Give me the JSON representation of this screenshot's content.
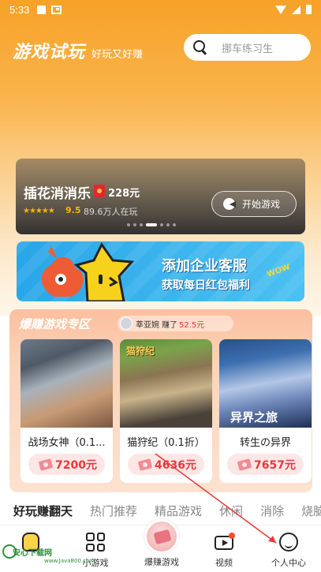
{
  "status_bar": {
    "time": "5:33"
  },
  "header": {
    "title": "游戏试玩",
    "subtitle": "好玩又好赚"
  },
  "search": {
    "placeholder": "挪车练习生"
  },
  "banner": {
    "game_name": "插花消消乐",
    "reward": "228元",
    "stars": "★★★★★",
    "rating": "9.5",
    "players": "89.6万人在玩",
    "start_label": "开始游戏",
    "slide_count": 7,
    "active_slide": 4
  },
  "promo": {
    "line1": "添加企业客服",
    "line2": "获取每日红包福利",
    "badge": "WOW"
  },
  "zone": {
    "title": "爆赚游戏专区",
    "ticker": {
      "name": "莘亚婉",
      "earned_label": "赚了",
      "amount": "52.5元"
    },
    "games": [
      {
        "name": "战场女神（0.1...",
        "price": "7200元",
        "art_label": ""
      },
      {
        "name": "猫狩纪（0.1折）",
        "price": "4636元",
        "art_label": "猫狩纪"
      },
      {
        "name": "转生の异界",
        "price": "7657元",
        "art_label": "异界之旅"
      }
    ]
  },
  "tabs": [
    "好玩赚翻天",
    "热门推荐",
    "精品游戏",
    "休闲",
    "消除",
    "烧脑"
  ],
  "bottom_nav": {
    "items": [
      {
        "label": "",
        "icon": "bear-icon"
      },
      {
        "label": "小游戏",
        "icon": "grid-icon"
      },
      {
        "label": "爆赚游戏",
        "icon": "money-icon"
      },
      {
        "label": "视频",
        "icon": "video-icon"
      },
      {
        "label": "个人中心",
        "icon": "face-icon"
      }
    ]
  },
  "watermark": {
    "text": "安心下载网",
    "url": "www.Java800.com"
  },
  "colors": {
    "accent_orange": "#f7a227",
    "price_red": "#e8393b",
    "promo_blue": "#29a6e8"
  }
}
